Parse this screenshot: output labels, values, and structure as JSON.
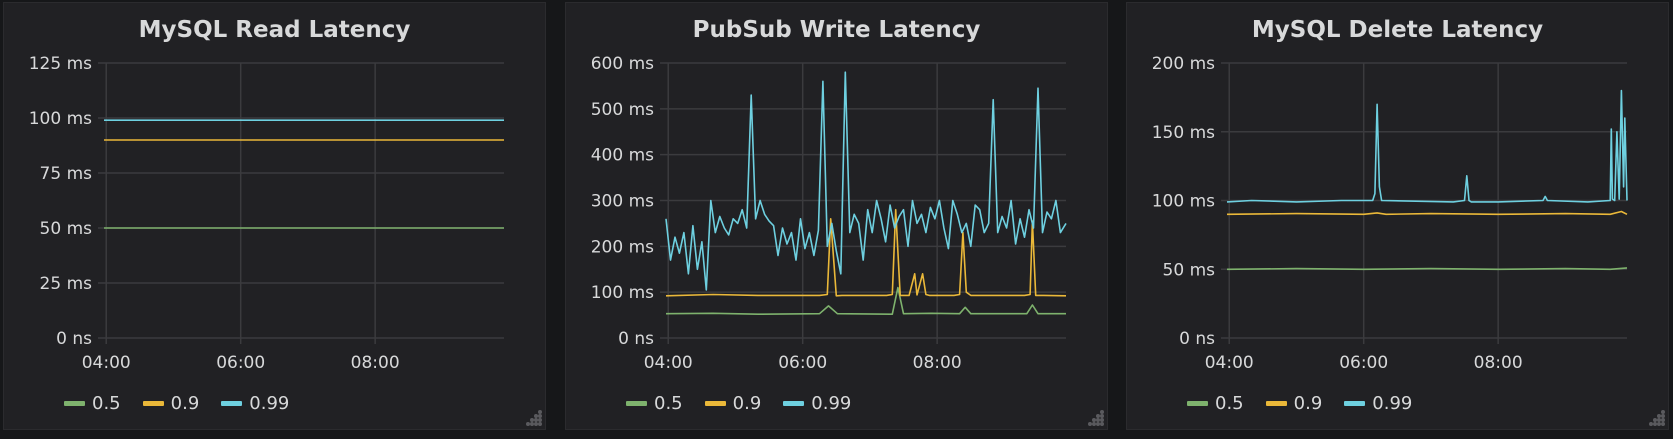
{
  "colors": {
    "p50": "#7eb26d",
    "p90": "#eab839",
    "p99": "#6ed0e0",
    "grid": "#3b3b3e",
    "axis_text": "#d8d9da"
  },
  "chart_data": [
    {
      "type": "line",
      "title": "MySQL Read Latency",
      "y_ticks": [
        "0 ns",
        "25 ms",
        "50 ms",
        "75 ms",
        "100 ms",
        "125 ms"
      ],
      "ylim": [
        0,
        125
      ],
      "x_ticks": [
        "04:00",
        "06:00",
        "08:00"
      ],
      "x_tick_hours": [
        4,
        6,
        8
      ],
      "xlim": [
        "03:58",
        "09:55"
      ],
      "legend_placement": "bottom-left",
      "series": [
        {
          "name": "0.5",
          "color": "#7eb26d",
          "x": [
            "03:58",
            "09:55"
          ],
          "values": [
            50,
            50
          ]
        },
        {
          "name": "0.9",
          "color": "#eab839",
          "x": [
            "03:58",
            "09:55"
          ],
          "values": [
            90,
            90
          ]
        },
        {
          "name": "0.99",
          "color": "#6ed0e0",
          "x": [
            "03:58",
            "09:55"
          ],
          "values": [
            99,
            99
          ]
        }
      ]
    },
    {
      "type": "line",
      "title": "PubSub Write Latency",
      "y_ticks": [
        "0 ns",
        "100 ms",
        "200 ms",
        "300 ms",
        "400 ms",
        "500 ms",
        "600 ms"
      ],
      "ylim": [
        0,
        600
      ],
      "x_ticks": [
        "04:00",
        "06:00",
        "08:00"
      ],
      "x_tick_hours": [
        4,
        6,
        8
      ],
      "xlim": [
        "03:58",
        "09:55"
      ],
      "legend_placement": "bottom-left",
      "series": [
        {
          "name": "0.5",
          "color": "#7eb26d",
          "x": [
            "03:58",
            "04:40",
            "05:20",
            "06:15",
            "06:23",
            "06:31",
            "07:20",
            "07:25",
            "07:30",
            "07:55",
            "08:20",
            "08:25",
            "08:30",
            "09:20",
            "09:25",
            "09:30",
            "09:55"
          ],
          "values": [
            53,
            54,
            52,
            53,
            70,
            53,
            52,
            110,
            53,
            54,
            53,
            67,
            53,
            53,
            72,
            53,
            53
          ]
        },
        {
          "name": "0.9",
          "color": "#eab839",
          "x": [
            "03:58",
            "04:40",
            "05:20",
            "06:15",
            "06:22",
            "06:25",
            "06:30",
            "06:35",
            "07:15",
            "07:20",
            "07:23",
            "07:27",
            "07:35",
            "07:40",
            "07:42",
            "07:47",
            "07:50",
            "07:53",
            "08:15",
            "08:20",
            "08:23",
            "08:26",
            "08:30",
            "09:18",
            "09:23",
            "09:25",
            "09:28",
            "09:35",
            "09:55"
          ],
          "values": [
            92,
            95,
            93,
            93,
            95,
            260,
            92,
            93,
            93,
            95,
            280,
            93,
            93,
            140,
            94,
            140,
            95,
            93,
            93,
            95,
            230,
            100,
            93,
            93,
            95,
            255,
            93,
            93,
            92
          ]
        },
        {
          "name": "0.99",
          "color": "#6ed0e0",
          "x": [
            "03:58",
            "04:02",
            "04:06",
            "04:10",
            "04:14",
            "04:18",
            "04:22",
            "04:26",
            "04:30",
            "04:34",
            "04:38",
            "04:42",
            "04:46",
            "04:50",
            "04:54",
            "04:58",
            "05:02",
            "05:06",
            "05:10",
            "05:14",
            "05:18",
            "05:22",
            "05:26",
            "05:30",
            "05:34",
            "05:38",
            "05:42",
            "05:46",
            "05:50",
            "05:54",
            "05:58",
            "06:02",
            "06:06",
            "06:10",
            "06:14",
            "06:18",
            "06:22",
            "06:26",
            "06:30",
            "06:34",
            "06:38",
            "06:42",
            "06:46",
            "06:50",
            "06:54",
            "06:58",
            "07:02",
            "07:06",
            "07:10",
            "07:14",
            "07:18",
            "07:22",
            "07:26",
            "07:30",
            "07:34",
            "07:38",
            "07:42",
            "07:46",
            "07:50",
            "07:54",
            "07:58",
            "08:02",
            "08:06",
            "08:10",
            "08:14",
            "08:18",
            "08:22",
            "08:26",
            "08:30",
            "08:34",
            "08:38",
            "08:42",
            "08:46",
            "08:50",
            "08:54",
            "08:58",
            "09:02",
            "09:06",
            "09:10",
            "09:14",
            "09:18",
            "09:22",
            "09:26",
            "09:30",
            "09:34",
            "09:38",
            "09:42",
            "09:46",
            "09:50",
            "09:55"
          ],
          "values": [
            260,
            170,
            220,
            185,
            230,
            140,
            245,
            150,
            210,
            105,
            300,
            230,
            265,
            240,
            225,
            260,
            250,
            280,
            240,
            530,
            260,
            300,
            270,
            255,
            245,
            180,
            240,
            205,
            230,
            170,
            260,
            195,
            230,
            180,
            235,
            560,
            200,
            250,
            190,
            140,
            580,
            230,
            270,
            250,
            170,
            280,
            230,
            300,
            260,
            210,
            290,
            240,
            265,
            280,
            200,
            300,
            250,
            270,
            230,
            285,
            260,
            300,
            240,
            195,
            300,
            270,
            230,
            250,
            200,
            290,
            280,
            230,
            250,
            520,
            230,
            265,
            240,
            300,
            205,
            260,
            220,
            280,
            240,
            545,
            230,
            275,
            260,
            300,
            230,
            250
          ]
        }
      ]
    },
    {
      "type": "line",
      "title": "MySQL Delete Latency",
      "y_ticks": [
        "0 ns",
        "50 ms",
        "100 ms",
        "150 ms",
        "200 ms"
      ],
      "ylim": [
        0,
        200
      ],
      "x_ticks": [
        "04:00",
        "06:00",
        "08:00"
      ],
      "x_tick_hours": [
        4,
        6,
        8
      ],
      "xlim": [
        "03:58",
        "09:55"
      ],
      "legend_placement": "bottom-left",
      "series": [
        {
          "name": "0.5",
          "color": "#7eb26d",
          "x": [
            "03:58",
            "05:00",
            "06:00",
            "07:00",
            "08:00",
            "09:00",
            "09:40",
            "09:55"
          ],
          "values": [
            50,
            50.5,
            50,
            50.5,
            50,
            50.5,
            50,
            51
          ]
        },
        {
          "name": "0.9",
          "color": "#eab839",
          "x": [
            "03:58",
            "05:00",
            "06:00",
            "06:12",
            "06:20",
            "07:00",
            "08:00",
            "09:00",
            "09:40",
            "09:50",
            "09:55"
          ],
          "values": [
            90,
            90.5,
            90,
            91,
            90,
            90.5,
            90,
            90.5,
            90,
            92,
            90
          ]
        },
        {
          "name": "0.99",
          "color": "#6ed0e0",
          "x": [
            "03:58",
            "04:20",
            "05:00",
            "05:40",
            "06:08",
            "06:10",
            "06:12",
            "06:14",
            "06:16",
            "07:20",
            "07:30",
            "07:32",
            "07:34",
            "07:36",
            "08:00",
            "08:40",
            "08:42",
            "08:44",
            "09:20",
            "09:40",
            "09:41",
            "09:42",
            "09:44",
            "09:46",
            "09:48",
            "09:50",
            "09:52",
            "09:53",
            "09:55"
          ],
          "values": [
            99,
            100,
            99,
            100,
            100,
            105,
            170,
            110,
            100,
            99,
            100,
            118,
            100,
            99,
            99,
            100,
            103,
            100,
            99,
            100,
            152,
            101,
            100,
            150,
            101,
            180,
            110,
            160,
            100
          ]
        }
      ]
    }
  ]
}
